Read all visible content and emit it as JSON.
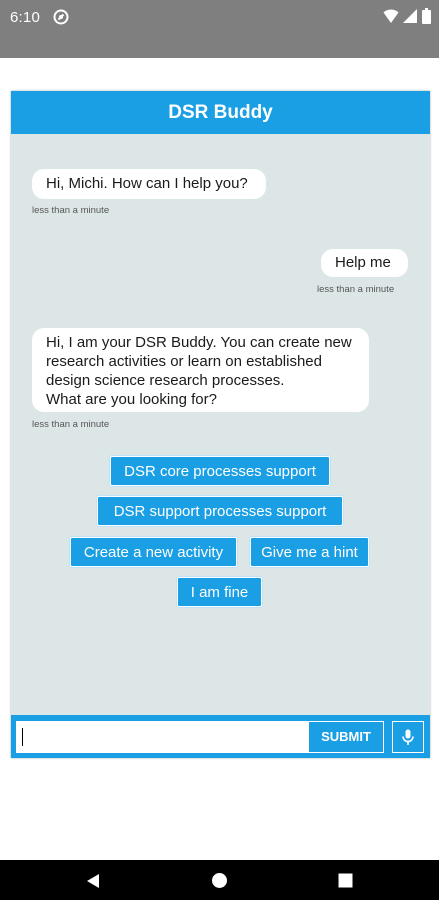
{
  "status_bar": {
    "time": "6:10",
    "icons": [
      "notification-app-icon",
      "wifi-icon",
      "cellular-signal-icon",
      "battery-icon"
    ]
  },
  "chat": {
    "title": "DSR Buddy",
    "messages": [
      {
        "sender": "bot",
        "text": "Hi, Michi. How can I help you?",
        "timestamp": "less than a minute"
      },
      {
        "sender": "user",
        "text": "Help me",
        "timestamp": "less than a minute"
      },
      {
        "sender": "bot",
        "lines": [
          "Hi, I am your DSR Buddy. You can create new",
          "research activities or learn on established",
          "design science research processes.",
          "What are you looking for?"
        ],
        "timestamp": "less than a minute"
      }
    ],
    "quick_replies": [
      "DSR core processes support",
      "DSR support processes support",
      "Create a new activity",
      "Give me a hint",
      "I am fine"
    ]
  },
  "input": {
    "value": "",
    "submit_label": "SUBMIT",
    "mic_icon": "microphone-icon"
  },
  "nav_bar": {
    "icons": [
      "back-icon",
      "home-icon",
      "recents-icon"
    ]
  },
  "colors": {
    "accent": "#1b9fe4",
    "chat_background": "#dde6e6",
    "status_bar": "#7f7f7f",
    "nav_bar": "#000000"
  }
}
